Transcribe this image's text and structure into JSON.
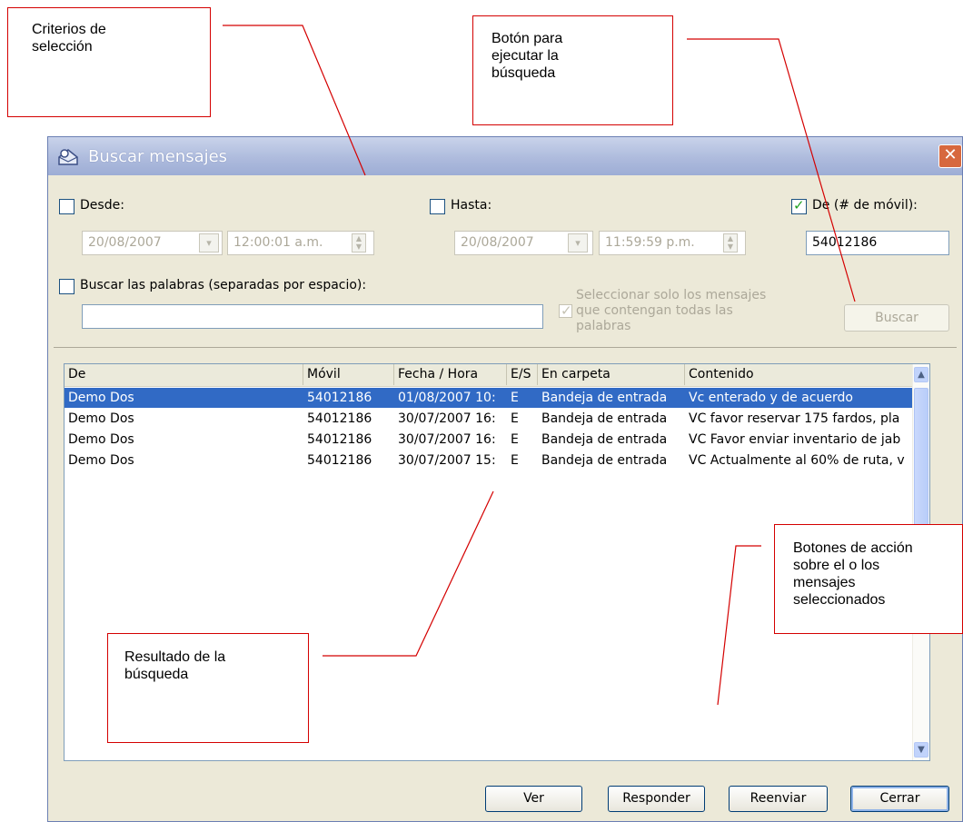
{
  "annotations": {
    "criteria": [
      "Criterios de",
      "selección"
    ],
    "search_button": [
      "Botón para",
      "ejecutar la",
      "búsqueda"
    ],
    "actions": [
      "Botones de acción",
      "sobre el o los",
      "mensajes",
      "seleccionados"
    ],
    "result": [
      "Resultado de la",
      "búsqueda"
    ]
  },
  "dialog": {
    "title": "Buscar mensajes",
    "close_label": "✕",
    "desde": {
      "label": "Desde:",
      "checked": false,
      "date": "20/08/2007",
      "time": "12:00:01 a.m."
    },
    "hasta": {
      "label": "Hasta:",
      "checked": false,
      "date": "20/08/2007",
      "time": "11:59:59 p.m."
    },
    "de_movil": {
      "label": "De (# de móvil):",
      "checked": true,
      "value": "54012186"
    },
    "words": {
      "label": "Buscar las palabras (separadas por espacio):",
      "checked": false,
      "value": ""
    },
    "all_words": {
      "label": [
        "Seleccionar solo los mensajes",
        "que contengan todas las",
        "palabras"
      ],
      "checked": true
    },
    "search_button": "Buscar",
    "columns": [
      "De",
      "Móvil",
      "Fecha / Hora",
      "E/S",
      "En carpeta",
      "Contenido"
    ],
    "rows": [
      {
        "de": "Demo Dos",
        "movil": "54012186",
        "fecha": "01/08/2007 10:",
        "es": "E",
        "carpeta": "Bandeja de entrada",
        "contenido": "Vc enterado y de acuerdo",
        "selected": true
      },
      {
        "de": "Demo Dos",
        "movil": "54012186",
        "fecha": "30/07/2007 16:",
        "es": "E",
        "carpeta": "Bandeja de entrada",
        "contenido": "VC favor reservar 175 fardos, pla",
        "selected": false
      },
      {
        "de": "Demo Dos",
        "movil": "54012186",
        "fecha": "30/07/2007 16:",
        "es": "E",
        "carpeta": "Bandeja de entrada",
        "contenido": "VC Favor enviar inventario de jab",
        "selected": false
      },
      {
        "de": "Demo Dos",
        "movil": "54012186",
        "fecha": "30/07/2007 15:",
        "es": "E",
        "carpeta": "Bandeja de entrada",
        "contenido": "VC Actualmente al 60% de ruta, v",
        "selected": false
      }
    ],
    "buttons": {
      "ver": "Ver",
      "responder": "Responder",
      "reenviar": "Reenviar",
      "cerrar": "Cerrar"
    }
  },
  "colors": {
    "annotation_line": "#d40000",
    "selection": "#316ac5",
    "titlebar": "#aebbdd"
  }
}
